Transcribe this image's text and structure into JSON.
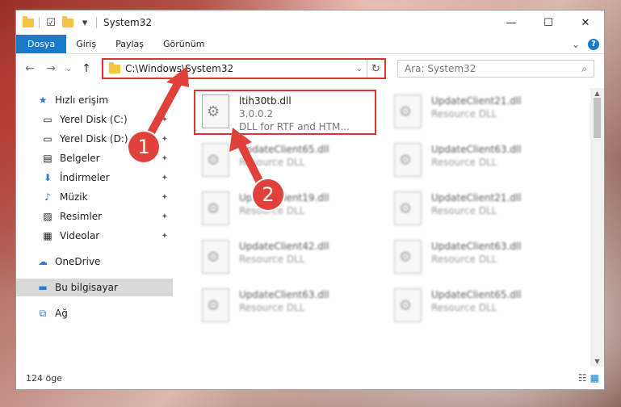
{
  "window": {
    "title": "System32",
    "min": "—",
    "max": "☐",
    "close": "✕"
  },
  "ribbon": {
    "tabs": [
      "Dosya",
      "Giriş",
      "Paylaş",
      "Görünüm"
    ],
    "expand": "⌄",
    "help": "?"
  },
  "address": {
    "path": "C:\\Windows\\System32",
    "refresh": "↻",
    "dropdown": "⌄"
  },
  "search": {
    "placeholder": "Ara: System32",
    "icon": "⌕"
  },
  "nav": {
    "back": "←",
    "forward": "→",
    "recent": "⌄",
    "up": "↑",
    "items": [
      {
        "label": "Hızlı erişim",
        "icon": "★"
      },
      {
        "label": "Yerel Disk (C:)",
        "icon": "▭"
      },
      {
        "label": "Yerel Disk (D:)",
        "icon": "▭"
      },
      {
        "label": "Belgeler",
        "icon": "▤"
      },
      {
        "label": "İndirmeler",
        "icon": "⬇"
      },
      {
        "label": "Müzik",
        "icon": "♪"
      },
      {
        "label": "Resimler",
        "icon": "▨"
      },
      {
        "label": "Videolar",
        "icon": "▦"
      },
      {
        "label": "OneDrive",
        "icon": "☁"
      },
      {
        "label": "Bu bilgisayar",
        "icon": "▬"
      },
      {
        "label": "Ağ",
        "icon": "⧉"
      }
    ]
  },
  "files": [
    {
      "name": "ltih30tb.dll",
      "sub1": "3.0.0.2",
      "sub2": "DLL for RTF and HTM..."
    },
    {
      "name": "UpdateClient21.dll",
      "sub1": "Resource DLL"
    },
    {
      "name": "UpdateClient65.dll",
      "sub1": "Resource DLL"
    },
    {
      "name": "UpdateClient63.dll",
      "sub1": "Resource DLL"
    },
    {
      "name": "UpdateClient19.dll",
      "sub1": "Resource DLL"
    },
    {
      "name": "UpdateClient21.dll",
      "sub1": "Resource DLL"
    },
    {
      "name": "UpdateClient42.dll",
      "sub1": "Resource DLL"
    },
    {
      "name": "UpdateClient63.dll",
      "sub1": "Resource DLL"
    },
    {
      "name": "UpdateClient63.dll",
      "sub1": "Resource DLL"
    },
    {
      "name": "UpdateClient65.dll",
      "sub1": "Resource DLL"
    }
  ],
  "status": {
    "count": "124 öge"
  },
  "callouts": [
    "1",
    "2"
  ],
  "colors": {
    "accent": "#1979ca",
    "highlight": "#dd3333",
    "callout": "#e0413a"
  }
}
